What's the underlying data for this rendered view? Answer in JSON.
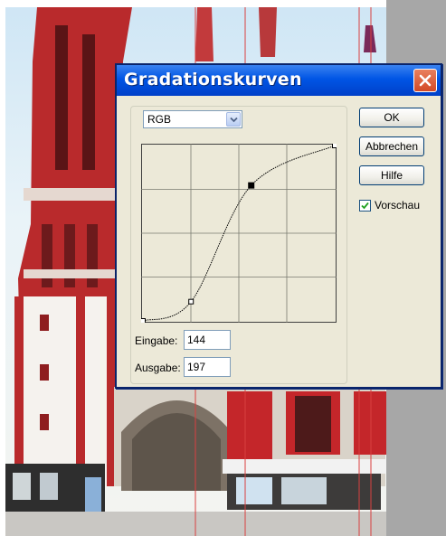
{
  "dialog": {
    "title": "Gradationskurven",
    "channel": {
      "selected": "RGB"
    },
    "curve": {
      "grid_divisions": 4,
      "points": [
        {
          "in": 0,
          "out": 0
        },
        {
          "in": 64,
          "out": 28
        },
        {
          "in": 144,
          "out": 197
        },
        {
          "in": 255,
          "out": 255
        }
      ],
      "selected_point": {
        "in": 144,
        "out": 197
      }
    },
    "input": {
      "label": "Eingabe:",
      "value": "144"
    },
    "output": {
      "label": "Ausgabe:",
      "value": "197"
    },
    "buttons": {
      "ok": "OK",
      "cancel": "Abbrechen",
      "help": "Hilfe"
    },
    "preview": {
      "label": "Vorschau",
      "checked": true
    }
  },
  "colors": {
    "titlebar": "#0055e5",
    "dialog_bg": "#ece9d8",
    "close_button": "#d34a27",
    "church_red": "#c8282a",
    "guide_line": "#d94040",
    "side_panel": "#a7a7a7"
  },
  "background": {
    "description_icon": "church-photo",
    "guide_line_count": 4
  }
}
